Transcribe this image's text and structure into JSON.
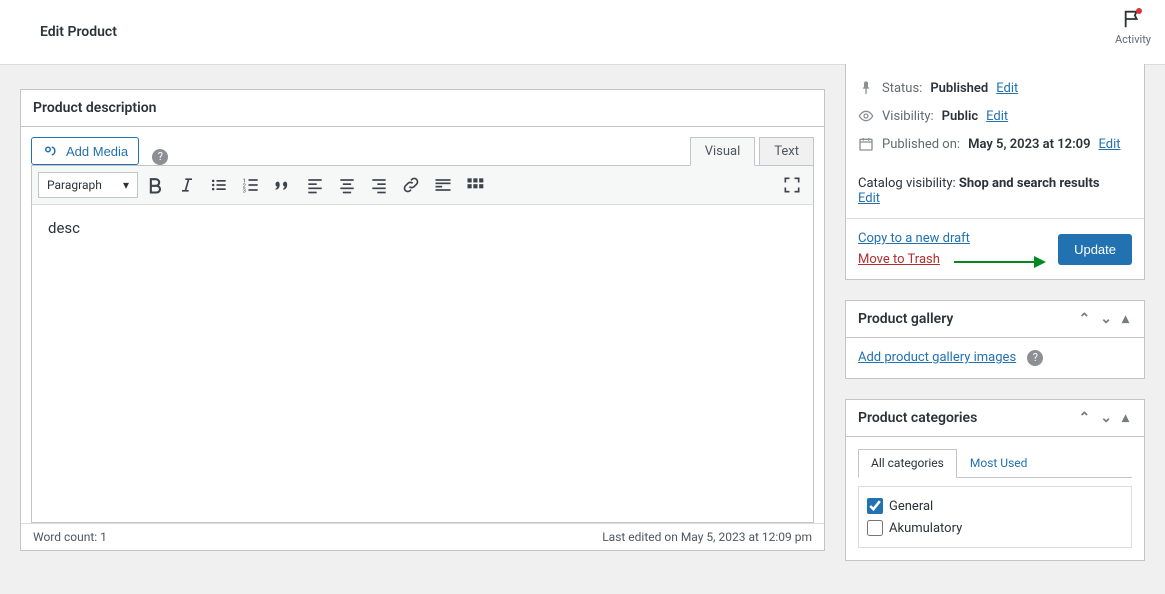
{
  "header": {
    "title": "Edit Product",
    "activity_label": "Activity"
  },
  "editor": {
    "box_title": "Product description",
    "add_media": "Add Media",
    "tabs": {
      "visual": "Visual",
      "text": "Text"
    },
    "format_select": "Paragraph",
    "content": "desc",
    "word_count_label": "Word count: 1",
    "last_edited": "Last edited on May 5, 2023 at 12:09 pm"
  },
  "publish": {
    "status_label": "Status:",
    "status_value": "Published",
    "visibility_label": "Visibility:",
    "visibility_value": "Public",
    "published_label": "Published on:",
    "published_value": "May 5, 2023 at 12:09",
    "edit_link": "Edit",
    "catalog_label": "Catalog visibility:",
    "catalog_value": "Shop and search results",
    "copy_link": "Copy to a new draft",
    "trash_link": "Move to Trash",
    "update_btn": "Update"
  },
  "gallery": {
    "title": "Product gallery",
    "add_link": "Add product gallery images"
  },
  "categories": {
    "title": "Product categories",
    "tab_all": "All categories",
    "tab_most": "Most Used",
    "items": [
      {
        "label": "General",
        "checked": true
      },
      {
        "label": "Akumulatory",
        "checked": false
      }
    ]
  }
}
